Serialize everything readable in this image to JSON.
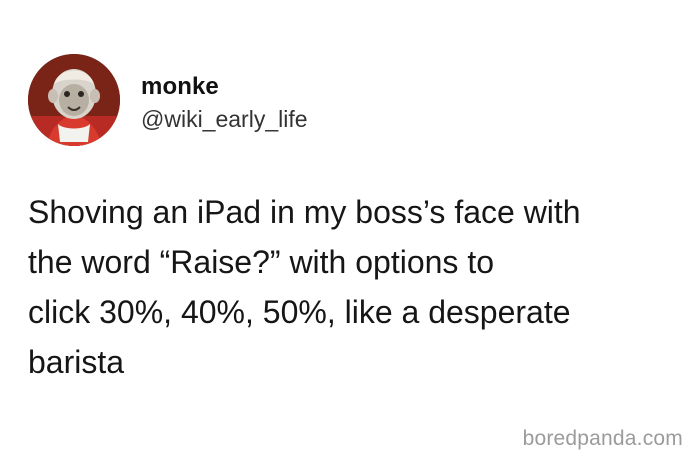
{
  "author": {
    "display_name": "monke",
    "handle": "@wiki_early_life",
    "avatar_icon": "monkey-portrait-avatar"
  },
  "tweet": {
    "text": "Shoving an iPad in my boss’s face with\nthe word “Raise?” with options to\nclick 30%, 40%, 50%, like a desperate\nbarista"
  },
  "watermark": "boredpanda.com",
  "colors": {
    "background": "#ffffff",
    "text": "#161616",
    "muted": "#333333",
    "watermark": "#9b9b9b",
    "avatar_bg": "#7a2418"
  }
}
